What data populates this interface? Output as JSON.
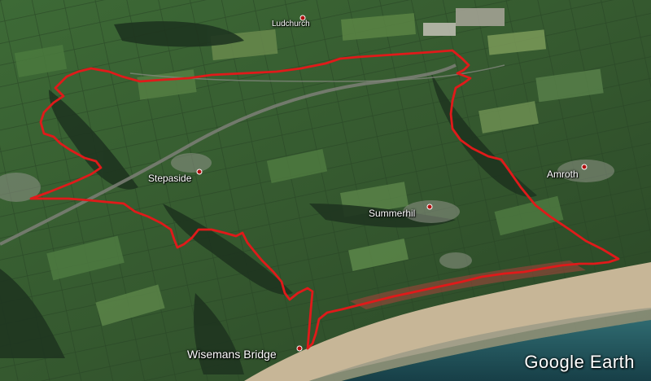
{
  "map": {
    "colors": {
      "route": "#e01a1a",
      "sea": "#1f5a62",
      "beach": "#c9b99a",
      "fields": "#3e6b35",
      "woodland": "#223a23"
    },
    "places": [
      {
        "id": "ludchurch",
        "label": "Ludchurch"
      },
      {
        "id": "stepaside",
        "label": "Stepaside"
      },
      {
        "id": "summerhill",
        "label": "Summerhil"
      },
      {
        "id": "amroth",
        "label": "Amroth"
      },
      {
        "id": "wisemans-bridge",
        "label": "Wisemans Bridge"
      }
    ],
    "watermark": "Google Earth"
  }
}
